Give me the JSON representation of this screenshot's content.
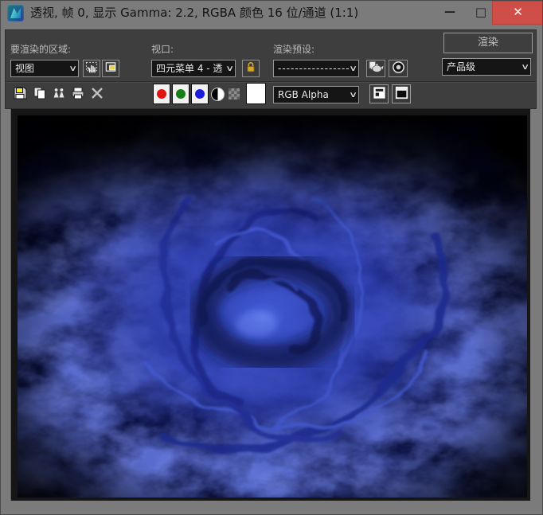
{
  "window": {
    "title": "透视, 帧 0, 显示 Gamma: 2.2, RGBA 颜色 16 位/通道 (1:1)"
  },
  "icons": {
    "minimize": "—",
    "maximize": "□",
    "close": "✕",
    "chevron_down": "∨"
  },
  "toolbar": {
    "area_label": "要渲染的区域:",
    "area_value": "视图",
    "viewport_label": "视口:",
    "viewport_value": "四元菜单 4 - 透",
    "preset_label": "渲染预设:",
    "preset_value": "--------------------",
    "render_button_label": "渲染",
    "render_mode_value": "产品级",
    "display_channel_value": "RGB Alpha"
  },
  "channels": {
    "red": "#e01212",
    "green": "#158015",
    "blue": "#1c1cdf"
  },
  "viewport_image": {
    "background": "#000000",
    "cloud_dark": "#141f66",
    "cloud_mid": "#2434a6",
    "vortex_glow": "#3349c6",
    "funnel_dark": "#101752",
    "center_highlight": "#5b76e8"
  }
}
